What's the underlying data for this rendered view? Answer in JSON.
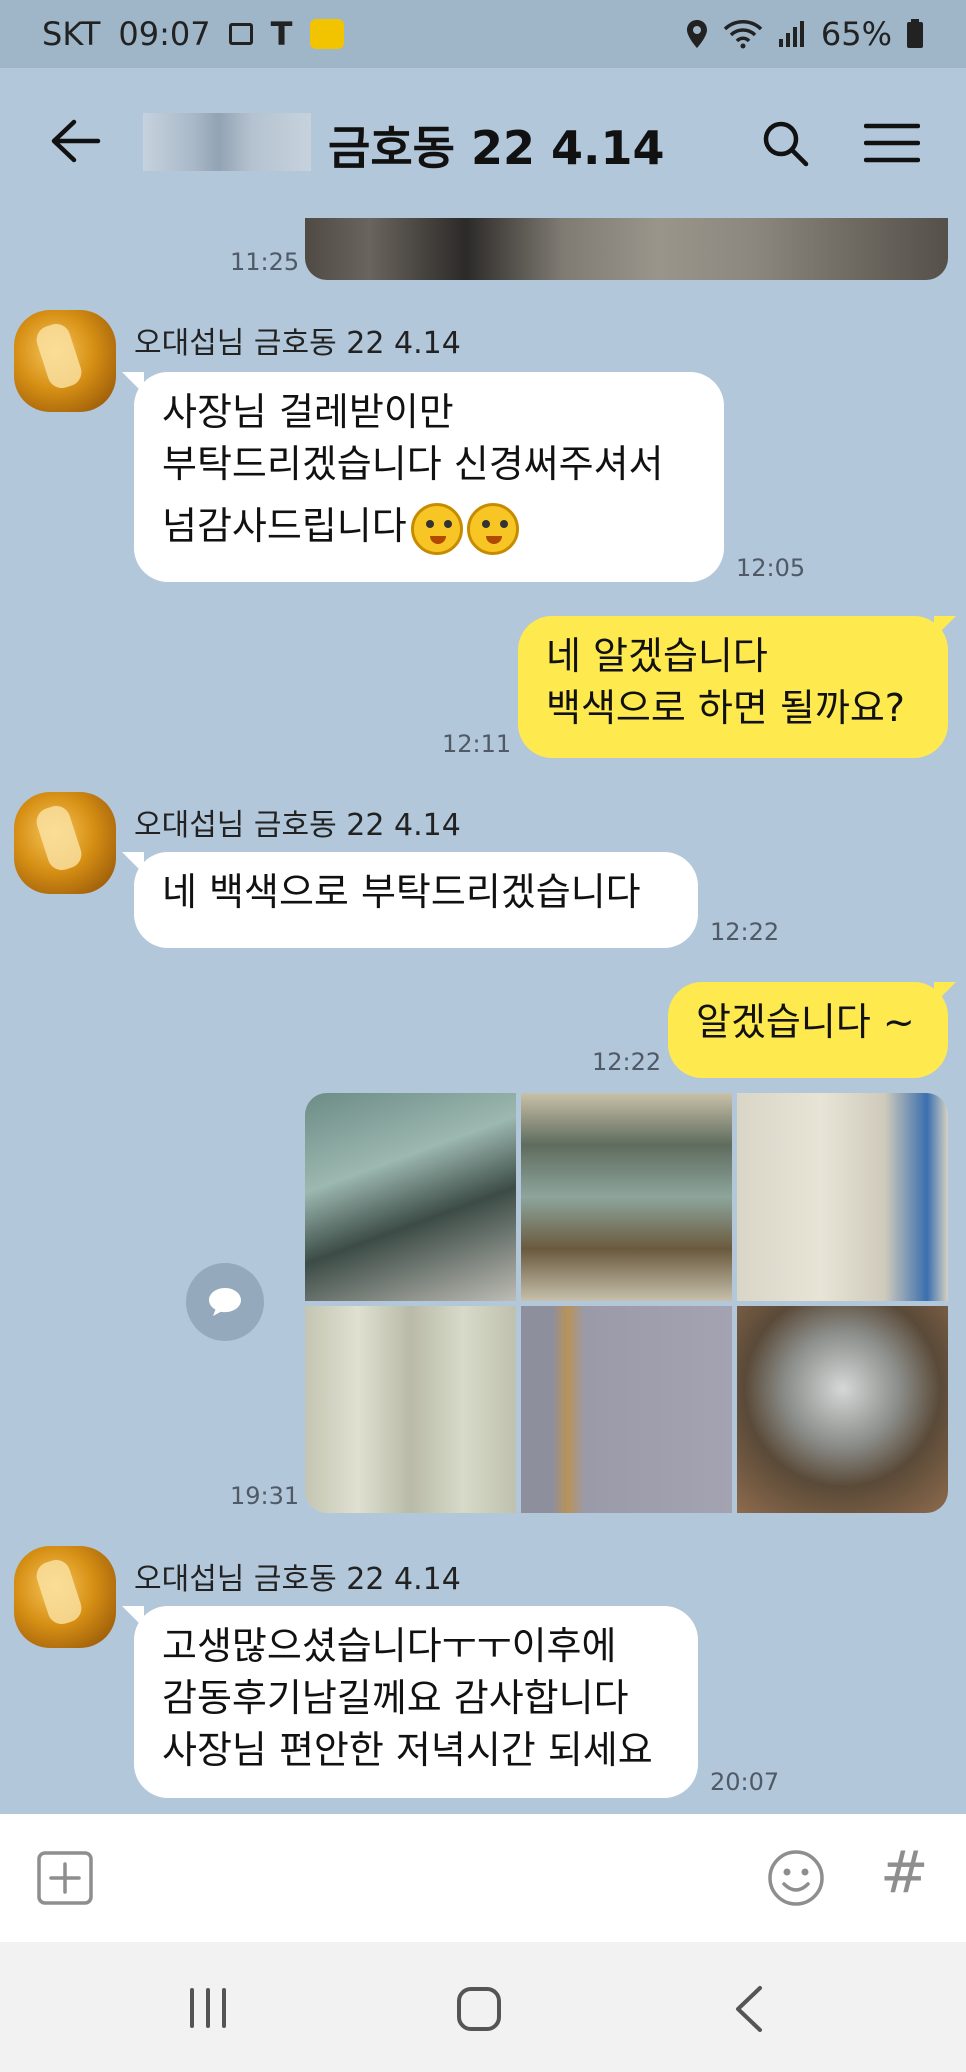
{
  "status_bar": {
    "carrier": "SKT",
    "time": "09:07",
    "battery": "65%"
  },
  "header": {
    "title": "금호동 22 4.14"
  },
  "messages": {
    "partial_image_time": "11:25",
    "m1": {
      "sender": "오대섭님 금호동 22 4.14",
      "line1": "사장님 걸레받이만",
      "line2": "부탁드리겠습니다 신경써주셔서",
      "line3": "넘감사드립니다",
      "time": "12:05"
    },
    "m2": {
      "line1": "네 알겠습니다",
      "line2": "백색으로 하면 될까요?",
      "time": "12:11"
    },
    "m3": {
      "sender": "오대섭님 금호동 22 4.14",
      "text": "네 백색으로 부탁드리겠습니다",
      "time": "12:22"
    },
    "m4": {
      "text": "알겠습니다 ~",
      "time": "12:22"
    },
    "photos_time": "19:31",
    "m5": {
      "sender": "오대섭님 금호동 22 4.14",
      "line1": "고생많으셨습니다ㅜㅜ이후에",
      "line2": "감동후기남길께요 감사합니다",
      "line3": "사장님 편안한 저녁시간 되세요",
      "time": "20:07"
    }
  },
  "input_bar": {
    "hash": "#"
  },
  "colors": {
    "chat_background": "#b2c7da",
    "my_bubble": "#fee94e",
    "their_bubble": "#ffffff"
  },
  "icons": [
    "back-arrow-icon",
    "search-icon",
    "menu-icon",
    "plus-icon",
    "emoji-icon",
    "share-icon",
    "recent-apps-icon",
    "home-icon",
    "nav-back-icon"
  ]
}
